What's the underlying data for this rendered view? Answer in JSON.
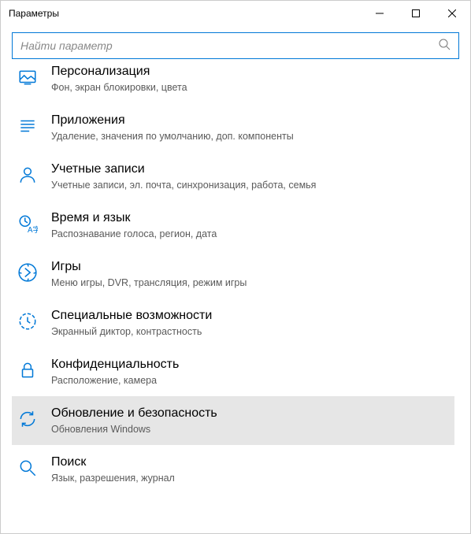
{
  "window": {
    "title": "Параметры"
  },
  "search": {
    "placeholder": "Найти параметр"
  },
  "items": [
    {
      "icon": "personalization-icon",
      "title": "Персонализация",
      "desc": "Фон, экран блокировки, цвета",
      "selected": false
    },
    {
      "icon": "apps-icon",
      "title": "Приложения",
      "desc": "Удаление, значения по умолчанию, доп. компоненты",
      "selected": false
    },
    {
      "icon": "accounts-icon",
      "title": "Учетные записи",
      "desc": "Учетные записи, эл. почта, синхронизация, работа, семья",
      "selected": false
    },
    {
      "icon": "time-language-icon",
      "title": "Время и язык",
      "desc": "Распознавание голоса, регион, дата",
      "selected": false
    },
    {
      "icon": "gaming-icon",
      "title": "Игры",
      "desc": "Меню игры, DVR, трансляция, режим игры",
      "selected": false
    },
    {
      "icon": "ease-of-access-icon",
      "title": "Специальные возможности",
      "desc": "Экранный диктор, контрастность",
      "selected": false
    },
    {
      "icon": "privacy-icon",
      "title": "Конфиденциальность",
      "desc": "Расположение, камера",
      "selected": false
    },
    {
      "icon": "update-security-icon",
      "title": "Обновление и безопасность",
      "desc": "Обновления Windows",
      "selected": true
    },
    {
      "icon": "search-category-icon",
      "title": "Поиск",
      "desc": "Язык, разрешения, журнал",
      "selected": false
    }
  ]
}
